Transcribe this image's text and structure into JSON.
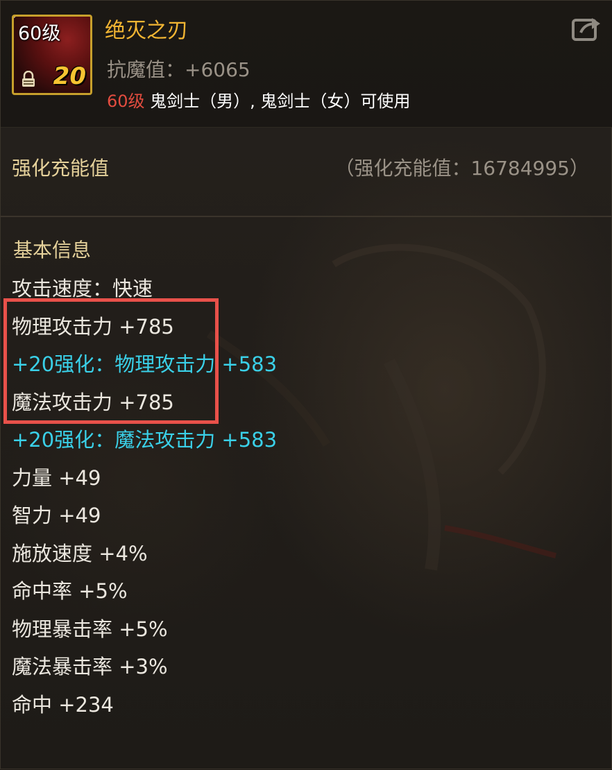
{
  "item": {
    "name": "绝灭之刃",
    "level_badge": "60级",
    "enhance_badge": "20",
    "stat_line": "抗魔值：+6065",
    "requirement": {
      "level": "60级",
      "classes": " 鬼剑士（男）, 鬼剑士（女）可使用"
    },
    "icon": "sword-blade-icon"
  },
  "header": {
    "share_icon": "share-icon"
  },
  "charge": {
    "label": "强化充能值",
    "value": "（强化充能值：16784995）"
  },
  "basic_info": {
    "title": "基本信息",
    "stats": [
      {
        "text": "攻击速度：快速",
        "type": "normal"
      },
      {
        "text": "物理攻击力 +785",
        "type": "normal"
      },
      {
        "text": "+20强化：物理攻击力 +583",
        "type": "enhance"
      },
      {
        "text": "魔法攻击力 +785",
        "type": "normal"
      },
      {
        "text": "+20强化：魔法攻击力 +583",
        "type": "enhance"
      },
      {
        "text": "力量 +49",
        "type": "normal"
      },
      {
        "text": "智力 +49",
        "type": "normal"
      },
      {
        "text": "施放速度 +4%",
        "type": "normal"
      },
      {
        "text": "命中率 +5%",
        "type": "normal"
      },
      {
        "text": "物理暴击率 +5%",
        "type": "normal"
      },
      {
        "text": "魔法暴击率 +3%",
        "type": "normal"
      },
      {
        "text": "命中 +234",
        "type": "normal"
      }
    ]
  },
  "colors": {
    "item_name": "#f2b533",
    "section_title": "#e6d29b",
    "enhance_text": "#3ad0e8",
    "requirement_level": "#e24c3f",
    "highlight_box": "#e8514a"
  }
}
